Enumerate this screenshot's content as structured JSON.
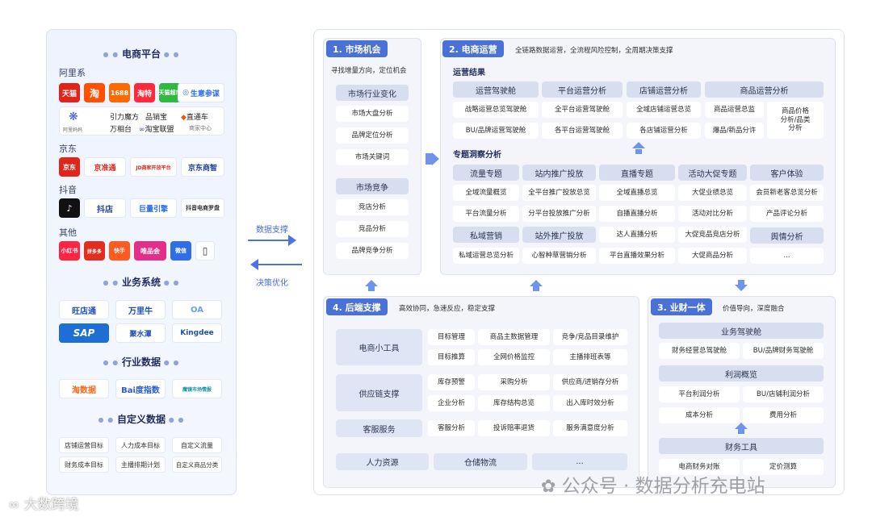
{
  "left": {
    "ecommerce_title": "电商平台",
    "ali_label": "阿里系",
    "ali_logos": [
      "天猫",
      "淘",
      "1688",
      "淘特",
      "天猫超市",
      "生意参谋"
    ],
    "ali_tools": {
      "brand": "阿里妈妈",
      "r1": [
        "引力魔方",
        "品销宝",
        "直通车"
      ],
      "r2": [
        "万相台",
        "淘宝联盟",
        "商家中心"
      ]
    },
    "jd_label": "京东",
    "jd_logos": [
      "京东",
      "京准通",
      "JD商家开放平台",
      "京东商智"
    ],
    "dy_label": "抖音",
    "dy_logos": [
      "抖音",
      "抖店",
      "巨量引擎",
      "抖音电商罗盘"
    ],
    "other_label": "其他",
    "other_logos": [
      "小红书",
      "拼多多",
      "快手",
      "唯品会",
      "微信",
      "手机"
    ],
    "biz_title": "业务系统",
    "biz_logos": [
      "旺店通",
      "万里牛",
      "OA",
      "SAP",
      "聚水潭",
      "Kingdee"
    ],
    "industry_title": "行业数据",
    "industry_logos": [
      "淘数据",
      "Bai度指数",
      "魔镜市场情报"
    ],
    "custom_title": "自定义数据",
    "custom_chips": [
      "店铺运营目标",
      "人力成本目标",
      "自定义流量",
      "财务成本目标",
      "主播排期计划",
      "自定义商品分类"
    ]
  },
  "arrows": {
    "support": "数据支撑",
    "decision": "决策优化"
  },
  "p1": {
    "tag": "1. 市场机会",
    "desc": "寻找增量方向，定位机会",
    "g1_header": "市场行业变化",
    "g1_items": [
      "市场大盘分析",
      "品牌定位分析",
      "市场关键词"
    ],
    "g2_header": "市场竞争",
    "g2_items": [
      "竞店分析",
      "竞品分析",
      "品牌竞争分析"
    ]
  },
  "p2": {
    "tag": "2. 电商运营",
    "desc": "全链路数据运营，全流程风险控制，全周期决策支撑",
    "results_title": "运营结果",
    "results_headers": [
      "运营驾驶舱",
      "平台运营分析",
      "店铺运营分析",
      "商品运营分析"
    ],
    "results_r1": [
      "战略运营总览驾驶舱",
      "全平台运营驾驶舱",
      "全域店铺运营总览",
      "商品运营总监"
    ],
    "results_r2": [
      "BU/品牌运营驾驶舱",
      "各平台运营驾驶舱",
      "各店铺运营分析",
      "爆品/新品分许"
    ],
    "price_cell": "商品价格\n分析/品类\n分析",
    "insight_title": "专题洞察分析",
    "ins_headers": [
      "流量专题",
      "站内推广投放",
      "直播专题",
      "活动大促专题",
      "客户体验"
    ],
    "ins_r1": [
      "全域流量概览",
      "全平台推广投放总览",
      "全域直播总览",
      "大促业绩总览",
      "会员新老客总览分析"
    ],
    "ins_r2": [
      "平台流量分析",
      "分平台投放推广分析",
      "自播直播分析",
      "活动对比分析",
      "产品评论分析"
    ],
    "ins_r3": [
      "私域营销",
      "站外推广投放",
      "达人直播分析",
      "大促竞品竞店分析",
      "舆情分析"
    ],
    "ins_r4": [
      "私域运营总览分析",
      "心智种草营销分析",
      "平台直播效果分析",
      "大促商品分析",
      "..."
    ]
  },
  "p4": {
    "tag": "4. 后端支撑",
    "desc": "高效协同，急速反应，稳定支撑",
    "rows": [
      {
        "label": "电商小工具",
        "items": [
          "目标管理",
          "商品主数据管理",
          "竞争/竞品目录维护",
          "目标推算",
          "全网价格监控",
          "主播排班表等"
        ]
      },
      {
        "label": "供应链支撑",
        "items": [
          "库存预警",
          "采购分析",
          "供应商/进销存分析",
          "企业分析",
          "库存结构总览",
          "出入库时效分析"
        ]
      },
      {
        "label": "客服服务",
        "items": [
          "客服分析",
          "投诉赔率退货",
          "服务满意度分析"
        ]
      }
    ],
    "bottom": [
      "人力资源",
      "仓储物流",
      "..."
    ]
  },
  "p3": {
    "tag": "3. 业财一体",
    "desc": "价值导向，深度融合",
    "h1": "业务驾驶舱",
    "r1": [
      "财务经营总驾驶舱",
      "BU/品牌财务驾驶舱"
    ],
    "h2": "利润概览",
    "r2": [
      "平台利润分析",
      "BU/店铺利润分析"
    ],
    "r3": [
      "成本分析",
      "费用分析"
    ],
    "h3": "财务工具",
    "r4": [
      "电商财务对账",
      "定价测算"
    ]
  },
  "watermarks": {
    "wechat": "公众号 · 数据分析充电站",
    "corner": "大数跨境"
  },
  "colors": {
    "accent": "#4a72d6",
    "panel_bg": "#f3f5fb",
    "header_bg": "#d7def0"
  }
}
